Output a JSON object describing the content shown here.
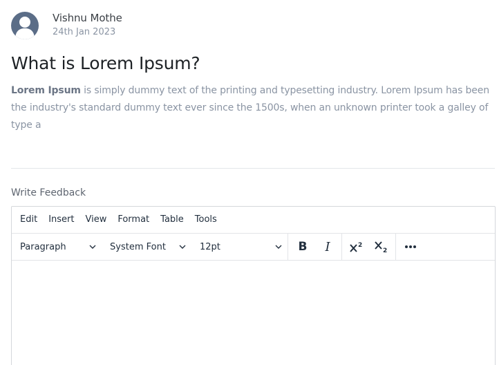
{
  "post": {
    "author_name": "Vishnu Mothe",
    "date": "24th Jan 2023",
    "title": "What is Lorem Ipsum?",
    "body_bold": "Lorem Ipsum",
    "body_rest": " is simply dummy text of the printing and typesetting industry. Lorem Ipsum has been the industry's standard dummy text ever since the 1500s, when an unknown printer took a galley of type a"
  },
  "feedback": {
    "label": "Write Feedback"
  },
  "editor": {
    "menu": [
      "Edit",
      "Insert",
      "View",
      "Format",
      "Table",
      "Tools"
    ],
    "block_format": "Paragraph",
    "font_family": "System Font",
    "font_size": "12pt",
    "buttons": {
      "bold": "B",
      "italic": "I",
      "more": "•••"
    },
    "icons": {
      "avatar": "user-avatar-icon",
      "chevron": "chevron-down-icon",
      "superscript": "superscript-icon",
      "subscript": "subscript-icon",
      "more": "more-horizontal-icon"
    }
  }
}
